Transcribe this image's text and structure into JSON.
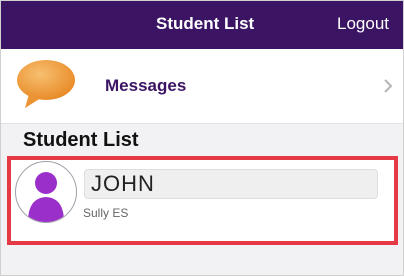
{
  "header": {
    "title": "Student List",
    "logout_label": "Logout",
    "background_color": "#3b1463"
  },
  "messages": {
    "label": "Messages",
    "icon": "chat-bubble-icon",
    "icon_color": "#f0a040",
    "chevron_icon": "chevron-right-icon"
  },
  "section": {
    "title": "Student List"
  },
  "students": [
    {
      "name": "JOHN",
      "school": "Sully ES",
      "avatar_icon": "person-avatar-icon",
      "avatar_color": "#9b2fc9"
    }
  ],
  "highlight_color": "#e53946"
}
